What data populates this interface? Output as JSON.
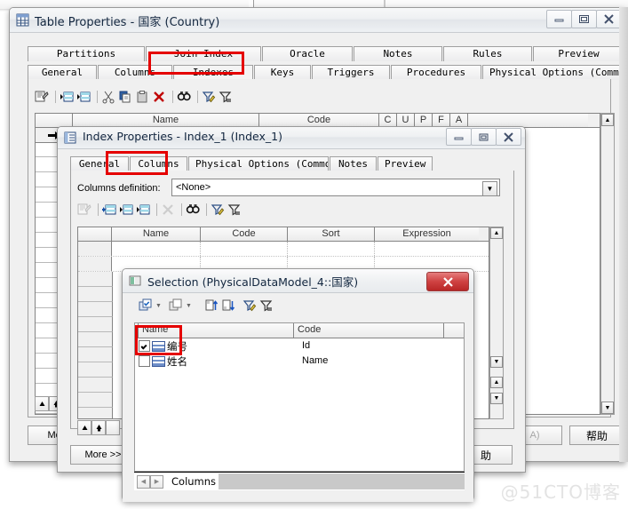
{
  "desktop": {
    "watermark": "@51CTO博客"
  },
  "table_properties": {
    "title": "Table Properties - 国家 (Country)",
    "icon": "table-icon",
    "sys_buttons": {
      "minimize": "—",
      "maximize": "❐",
      "close": "✕"
    },
    "tabs_row1": [
      "Partitions",
      "Join Index",
      "Oracle",
      "Notes",
      "Rules",
      "Preview"
    ],
    "tabs_row2": [
      "General",
      "Columns",
      "Indexes",
      "Keys",
      "Triggers",
      "Procedures",
      "Physical Options (Common)"
    ],
    "selected_tab": "Indexes",
    "toolbar_icons": [
      "properties-icon",
      "insert-row-icon",
      "add-row-icon",
      "cut-icon",
      "copy-icon",
      "paste-icon",
      "delete-icon",
      "find-icon",
      "filter-edit-icon",
      "filter-icon"
    ],
    "grid_headers": [
      "",
      "Name",
      "Code",
      "C",
      "U",
      "P",
      "F",
      "A"
    ],
    "more_button": "More",
    "help_button": "帮助",
    "partial_button": "A)"
  },
  "index_properties": {
    "title": "Index Properties - Index_1 (Index_1)",
    "icon": "index-icon",
    "sys_buttons": {
      "minimize": "—",
      "maximize": "❐",
      "close": "✕"
    },
    "tabs": [
      "General",
      "Columns",
      "Physical Options (Common)",
      "Notes",
      "Preview"
    ],
    "selected_tab": "Columns",
    "columns_definition_label": "Columns definition:",
    "columns_definition_value": "<None>",
    "toolbar_icons": [
      "properties-icon",
      "add-column-icon",
      "insert-row-icon",
      "add-row-icon",
      "delete-icon",
      "find-icon",
      "filter-edit-icon",
      "filter-icon"
    ],
    "grid_headers": [
      "",
      "Name",
      "Code",
      "Sort",
      "Expression"
    ],
    "more_button": "More >>",
    "help_button": "助"
  },
  "selection_dialog": {
    "title": "Selection (PhysicalDataModel_4::国家)",
    "icon": "selection-icon",
    "close_button": "✕",
    "toolbar_icons": [
      "select-all-icon",
      "deselect-all-icon",
      "sort-asc-icon",
      "sort-desc-icon",
      "filter-edit-icon",
      "filter-icon"
    ],
    "grid_headers": [
      "",
      "Name",
      "Code",
      ""
    ],
    "rows": [
      {
        "checked": true,
        "icon": "column-icon",
        "name": "编号",
        "code": "Id"
      },
      {
        "checked": false,
        "icon": "column-icon",
        "name": "姓名",
        "code": "Name"
      }
    ],
    "bottom_tab": "Columns",
    "nav_prev": "◄",
    "nav_next": "►"
  },
  "highlights": [
    {
      "name": "indexes-tab-highlight",
      "color": "#e50000"
    },
    {
      "name": "columns-tab-highlight",
      "color": "#e50000"
    },
    {
      "name": "checked-row-highlight",
      "color": "#e50000"
    }
  ]
}
